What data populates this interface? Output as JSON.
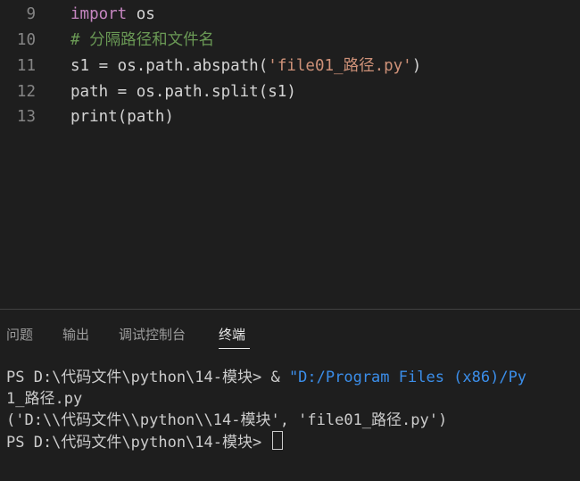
{
  "editor": {
    "lines": [
      {
        "number": "9",
        "tokens": [
          {
            "text": "import",
            "kind": "keyword"
          },
          {
            "text": " os",
            "kind": "plain"
          }
        ]
      },
      {
        "number": "10",
        "tokens": [
          {
            "text": "# 分隔路径和文件名",
            "kind": "comment"
          }
        ]
      },
      {
        "number": "11",
        "tokens": [
          {
            "text": "s1 = os.path.",
            "kind": "plain"
          },
          {
            "text": "abspath",
            "kind": "plain"
          },
          {
            "text": "(",
            "kind": "plain"
          },
          {
            "text": "'file01_路径.py'",
            "kind": "string"
          },
          {
            "text": ")",
            "kind": "plain"
          }
        ]
      },
      {
        "number": "12",
        "tokens": [
          {
            "text": "path = os.path.split(s1)",
            "kind": "plain"
          }
        ]
      },
      {
        "number": "13",
        "tokens": [
          {
            "text": "print",
            "kind": "plain"
          },
          {
            "text": "(path)",
            "kind": "plain"
          }
        ]
      }
    ]
  },
  "panel": {
    "tabs": [
      {
        "label": "问题",
        "active": false
      },
      {
        "label": "输出",
        "active": false
      },
      {
        "label": "调试控制台",
        "active": false
      },
      {
        "label": "终端",
        "active": true
      }
    ]
  },
  "terminal": {
    "line1_prompt": "PS D:\\代码文件\\python\\14-模块> & ",
    "line1_string": "\"D:/Program Files (x86)/Py",
    "line2": "1_路径.py",
    "line3": "('D:\\\\代码文件\\\\python\\\\14-模块', 'file01_路径.py')",
    "line4_prompt": "PS D:\\代码文件\\python\\14-模块> "
  },
  "colors": {
    "background": "#1e1e1e",
    "keyword": "#c586c0",
    "comment": "#6a9955",
    "string": "#ce9178",
    "line_number": "#858585",
    "terminal_text": "#cccccc",
    "terminal_string": "#3b8eea"
  }
}
